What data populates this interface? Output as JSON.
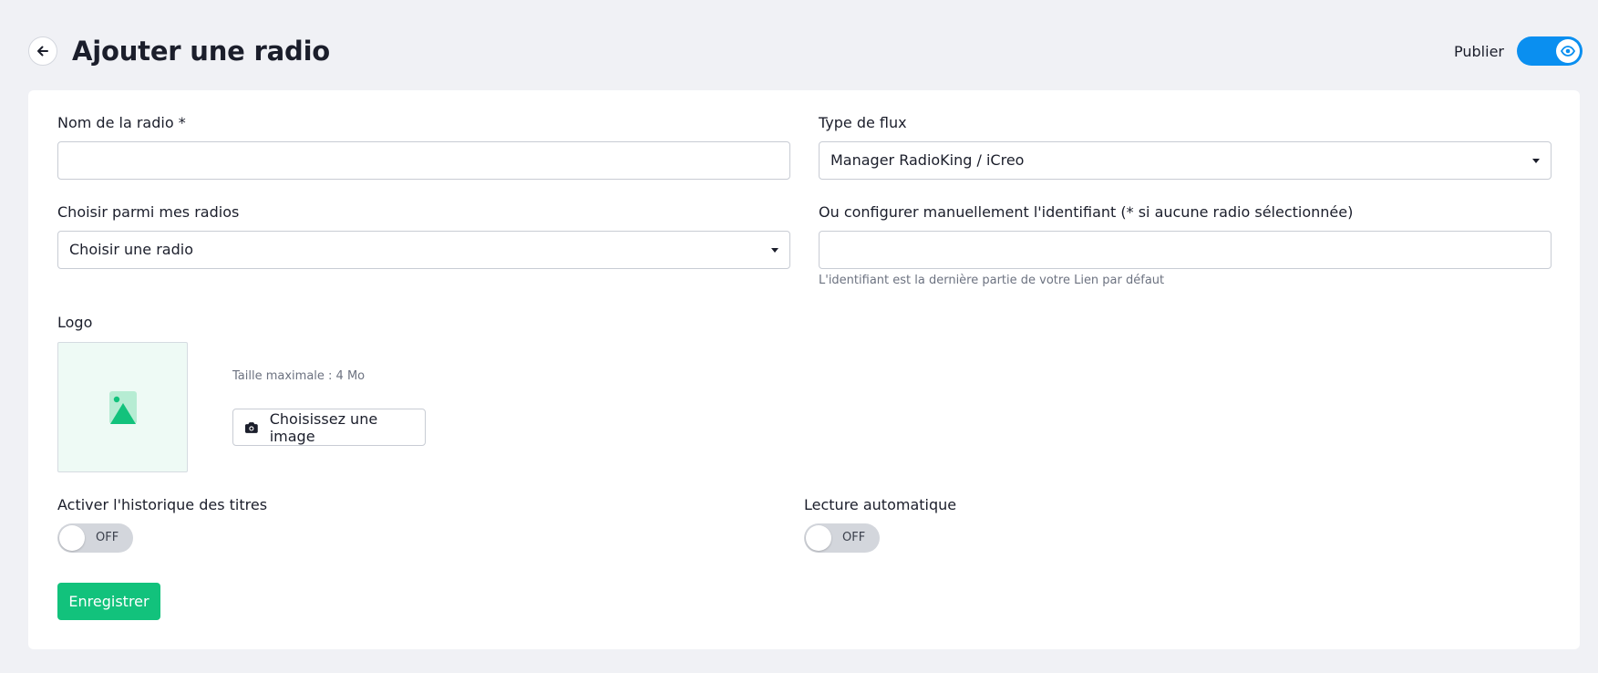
{
  "header": {
    "title": "Ajouter une radio",
    "publish_label": "Publier",
    "publish_on": true
  },
  "form": {
    "name": {
      "label": "Nom de la radio *",
      "value": ""
    },
    "stream_type": {
      "label": "Type de flux",
      "value": "Manager RadioKing / iCreo"
    },
    "my_radios": {
      "label": "Choisir parmi mes radios",
      "value": "Choisir une radio"
    },
    "identifier": {
      "label": "Ou configurer manuellement l'identifiant (* si aucune radio sélectionnée)",
      "value": "",
      "help": "L'identifiant est la dernière partie de votre Lien par défaut"
    },
    "logo": {
      "label": "Logo",
      "max_size": "Taille maximale : 4 Mo",
      "button_label": "Choisissez une image"
    },
    "history": {
      "label": "Activer l'historique des titres",
      "state": "OFF"
    },
    "autoplay": {
      "label": "Lecture automatique",
      "state": "OFF"
    },
    "save_label": "Enregistrer"
  },
  "colors": {
    "accent_blue": "#0a8ff0",
    "accent_green": "#12c27c",
    "background": "#f0f1f5"
  },
  "icons": [
    "arrow-left-icon",
    "eye-icon",
    "image-placeholder-icon",
    "camera-icon",
    "caret-down-icon"
  ]
}
